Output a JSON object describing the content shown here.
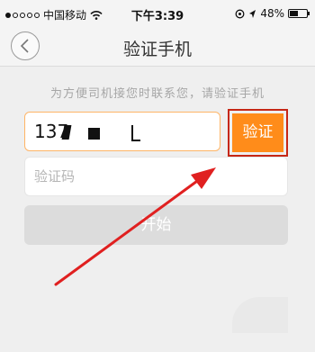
{
  "status_bar": {
    "carrier": "中国移动",
    "time": "下午3:39",
    "battery_percent": "48%",
    "battery_level": 0.48,
    "signal_dots_filled": 1,
    "signal_dots_total": 5
  },
  "nav": {
    "title": "验证手机",
    "back_icon": "chevron-left-icon"
  },
  "hint_text": "为方便司机接您时联系您，请验证手机",
  "phone_field": {
    "value_visible": "137"
  },
  "verify_button": {
    "label": "验证",
    "color": "#ff8c1a",
    "highlight_color": "#c62716"
  },
  "code_field": {
    "placeholder": "验证码"
  },
  "start_button": {
    "label": "开始",
    "color": "#dcdcdc"
  },
  "annotation": {
    "arrow_color": "#e02020"
  }
}
